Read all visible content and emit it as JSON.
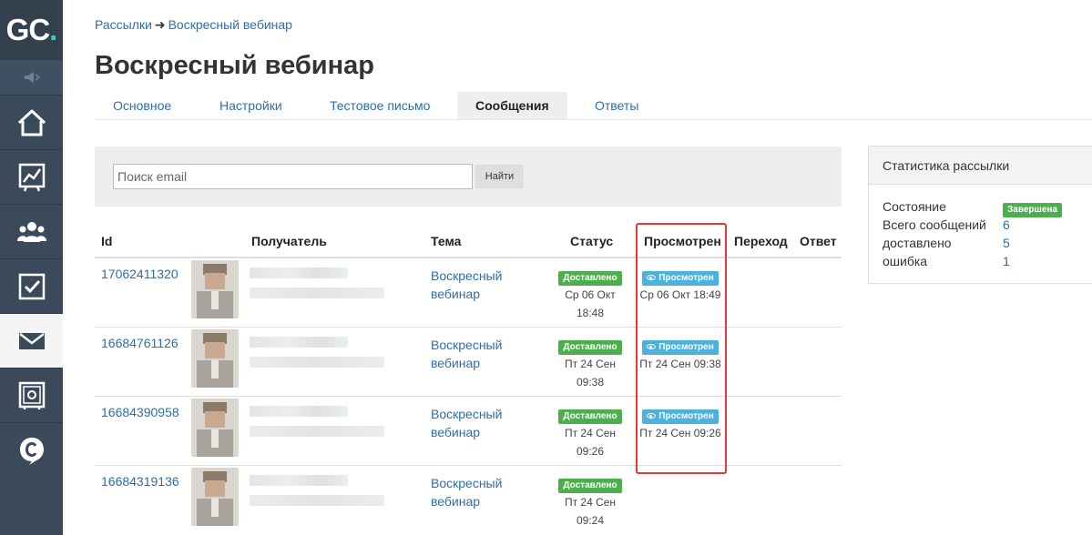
{
  "app": {
    "logo_text": "GC",
    "logo_dot": "."
  },
  "sidebar": {
    "items": [
      {
        "name": "home-icon"
      },
      {
        "name": "chart-icon"
      },
      {
        "name": "users-icon"
      },
      {
        "name": "tasks-icon"
      },
      {
        "name": "mail-icon",
        "active": true
      },
      {
        "name": "safe-icon"
      },
      {
        "name": "chat-icon"
      }
    ]
  },
  "breadcrumb": {
    "parent": "Рассылки",
    "separator": "➜",
    "current": "Воскресный вебинар"
  },
  "page": {
    "title": "Воскресный вебинар"
  },
  "tabs": [
    {
      "label": "Основное"
    },
    {
      "label": "Настройки"
    },
    {
      "label": "Тестовое письмо"
    },
    {
      "label": "Сообщения",
      "active": true
    },
    {
      "label": "Ответы"
    }
  ],
  "search": {
    "placeholder": "Поиск email",
    "button_label": "Найти"
  },
  "table": {
    "headers": {
      "id": "Id",
      "recipient": "Получатель",
      "topic": "Тема",
      "status": "Статус",
      "viewed": "Просмотрен",
      "click": "Переход",
      "reply": "Ответ"
    },
    "rows": [
      {
        "id": "17062411320",
        "topic": "Воскресный вебинар",
        "status": "Доставлено",
        "status_date": "Ср 06 Окт 18:48",
        "viewed": "Просмотрен",
        "viewed_date": "Ср 06 Окт 18:49"
      },
      {
        "id": "16684761126",
        "topic": "Воскресный вебинар",
        "status": "Доставлено",
        "status_date": "Пт 24 Сен 09:38",
        "viewed": "Просмотрен",
        "viewed_date": "Пт 24 Сен 09:38"
      },
      {
        "id": "16684390958",
        "topic": "Воскресный вебинар",
        "status": "Доставлено",
        "status_date": "Пт 24 Сен 09:26",
        "viewed": "Просмотрен",
        "viewed_date": "Пт 24 Сен 09:26"
      },
      {
        "id": "16684319136",
        "topic": "Воскресный вебинар",
        "status": "Доставлено",
        "status_date": "Пт 24 Сен 09:24",
        "viewed": "",
        "viewed_date": ""
      }
    ]
  },
  "stats": {
    "title": "Статистика рассылки",
    "state_label": "Состояние",
    "state_value": "Завершена",
    "total_label": "Всего сообщений",
    "total_value": "6",
    "delivered_label": "доставлено",
    "delivered_value": "5",
    "error_label": "ошибка",
    "error_value": "1"
  },
  "colors": {
    "sidebar": "#3b4a5a",
    "link": "#2a6fab",
    "delivered": "#4cae4c",
    "viewed": "#4cb2dc",
    "highlight": "#e53935"
  }
}
